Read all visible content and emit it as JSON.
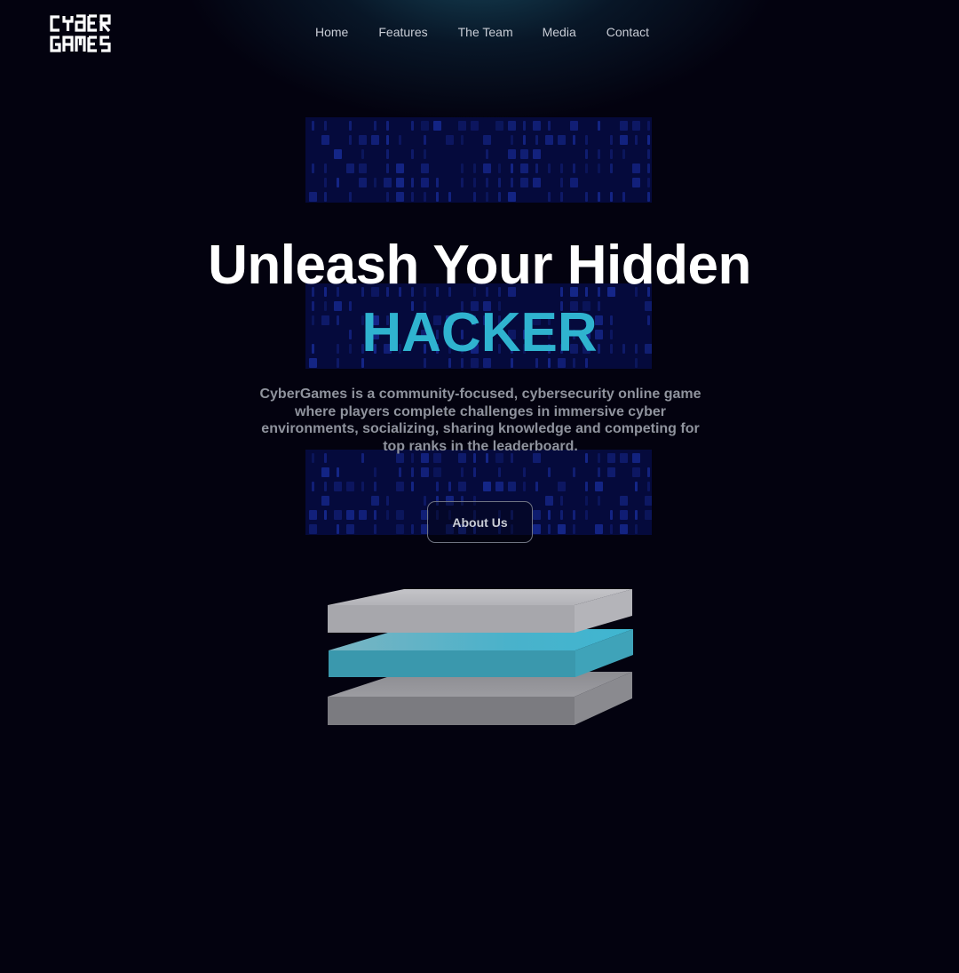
{
  "logo": {
    "line1": "CYBER",
    "line2": "GAMES"
  },
  "nav": {
    "items": [
      {
        "label": "Home"
      },
      {
        "label": "Features"
      },
      {
        "label": "The Team"
      },
      {
        "label": "Media"
      },
      {
        "label": "Contact"
      }
    ]
  },
  "hero": {
    "title": "Unleash Your Hidden",
    "accent": "HACKER",
    "description": "CyberGames is a community-focused, cybersecurity online game where players complete challenges in immersive cyber environments, socializing, sharing knowledge and competing for top ranks in the leaderboard.",
    "button_label": "About Us"
  },
  "colors": {
    "background": "#03020f",
    "accent": "#2fb3cf",
    "matrix_block": "#050a3c",
    "layer_gray": "#a7a7ac",
    "layer_blue": "#3a98ad"
  },
  "icons": {
    "logo": "cybergames-logo",
    "illustration": "stacked-layers-illustration"
  }
}
